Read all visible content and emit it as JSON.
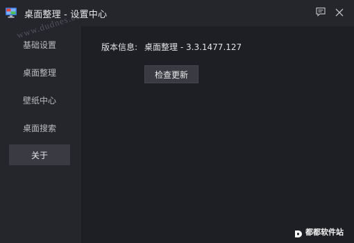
{
  "window": {
    "title": "桌面整理 - 设置中心",
    "icons": {
      "app": "monitor-icon",
      "feedback": "message-icon",
      "close": "close-icon"
    }
  },
  "sidebar": {
    "items": [
      {
        "label": "基础设置",
        "active": false
      },
      {
        "label": "桌面整理",
        "active": false
      },
      {
        "label": "壁纸中心",
        "active": false
      },
      {
        "label": "桌面搜索",
        "active": false
      },
      {
        "label": "关于",
        "active": true
      }
    ]
  },
  "about": {
    "version_label": "版本信息:",
    "version_value": "桌面整理 - 3.3.1477.127",
    "check_button": "检查更新"
  },
  "overlay": {
    "watermark_text": "www.dudnes.com",
    "brand_text": "都都软件站"
  },
  "colors": {
    "background": "#1e1f24",
    "sidebar": "#25262b",
    "active_item": "#3a3b42",
    "text": "#d4d5d8"
  }
}
